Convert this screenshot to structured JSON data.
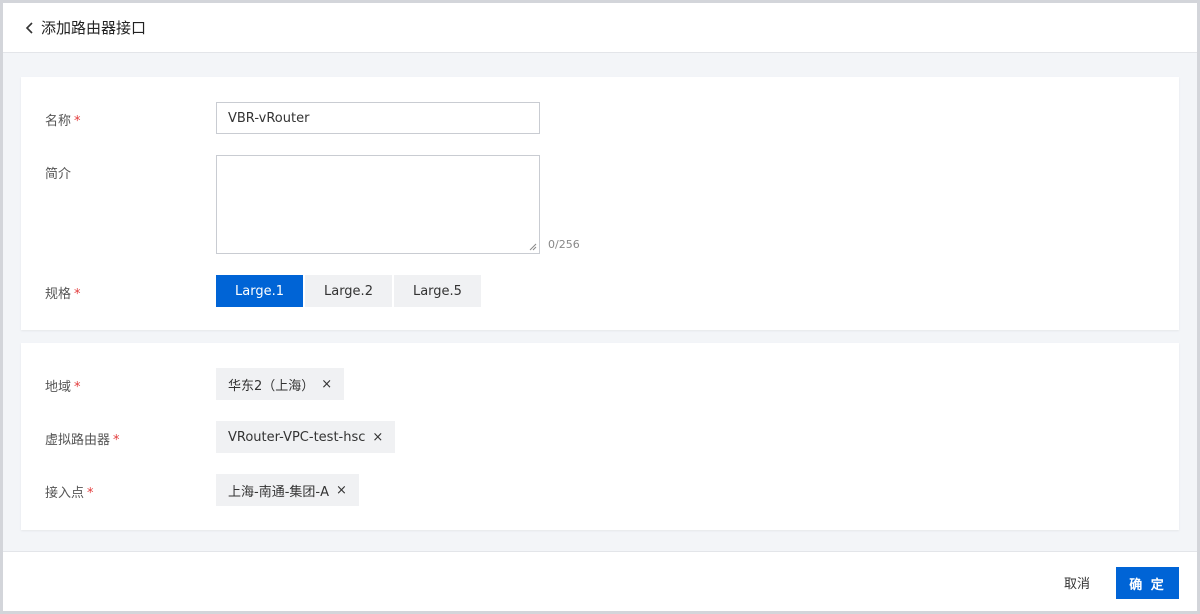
{
  "header": {
    "title": "添加路由器接口",
    "back_icon": "chevron-left-icon"
  },
  "basic": {
    "name": {
      "label": "名称",
      "required": "*",
      "value": "VBR-vRouter"
    },
    "description": {
      "label": "简介",
      "value": "",
      "counter": "0/256"
    },
    "spec": {
      "label": "规格",
      "required": "*",
      "options": [
        "Large.1",
        "Large.2",
        "Large.5"
      ],
      "selected": "Large.1"
    }
  },
  "location": {
    "region": {
      "label": "地域",
      "required": "*",
      "value": "华东2（上海）"
    },
    "router": {
      "label": "虚拟路由器",
      "required": "*",
      "value": "VRouter-VPC-test-hsc"
    },
    "access_point": {
      "label": "接入点",
      "required": "*",
      "value": "上海-南通-集团-A"
    },
    "remove_glyph": "×"
  },
  "footer": {
    "cancel_label": "取消",
    "confirm_label": "确 定"
  },
  "colors": {
    "primary": "#0064d6",
    "required": "#e23a3a",
    "background": "#f3f5f8"
  }
}
